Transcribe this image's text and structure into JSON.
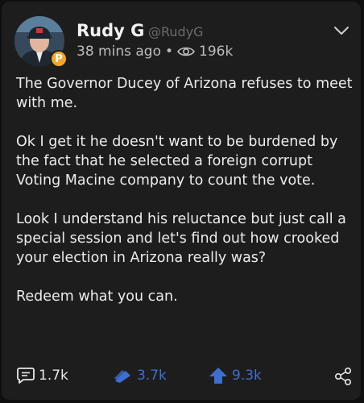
{
  "post": {
    "author_name": "Rudy G",
    "author_handle": "@RudyG",
    "time_ago": "38 mins ago",
    "views": "196k",
    "paragraphs": [
      "The Governor Ducey of Arizona refuses to meet with me.",
      "Ok I get it he doesn't want to be burdened by the fact that he selected a foreign corrupt Voting Macine company to count the vote.",
      "Look I understand his reluctance but just call a special session and let's find out how crooked your election in Arizona really was?",
      "Redeem what you can."
    ]
  },
  "actions": {
    "comments": "1.7k",
    "echoes": "3.7k",
    "upvotes": "9.3k"
  },
  "colors": {
    "background": "#1d1d1d",
    "text": "#ececec",
    "accent_blue": "#3d6fd1",
    "badge_orange": "#f3a72a"
  },
  "icons": [
    "parler-badge-icon",
    "eye-icon",
    "chevron-down-icon",
    "comment-icon",
    "echo-icon",
    "upvote-icon",
    "share-icon"
  ]
}
